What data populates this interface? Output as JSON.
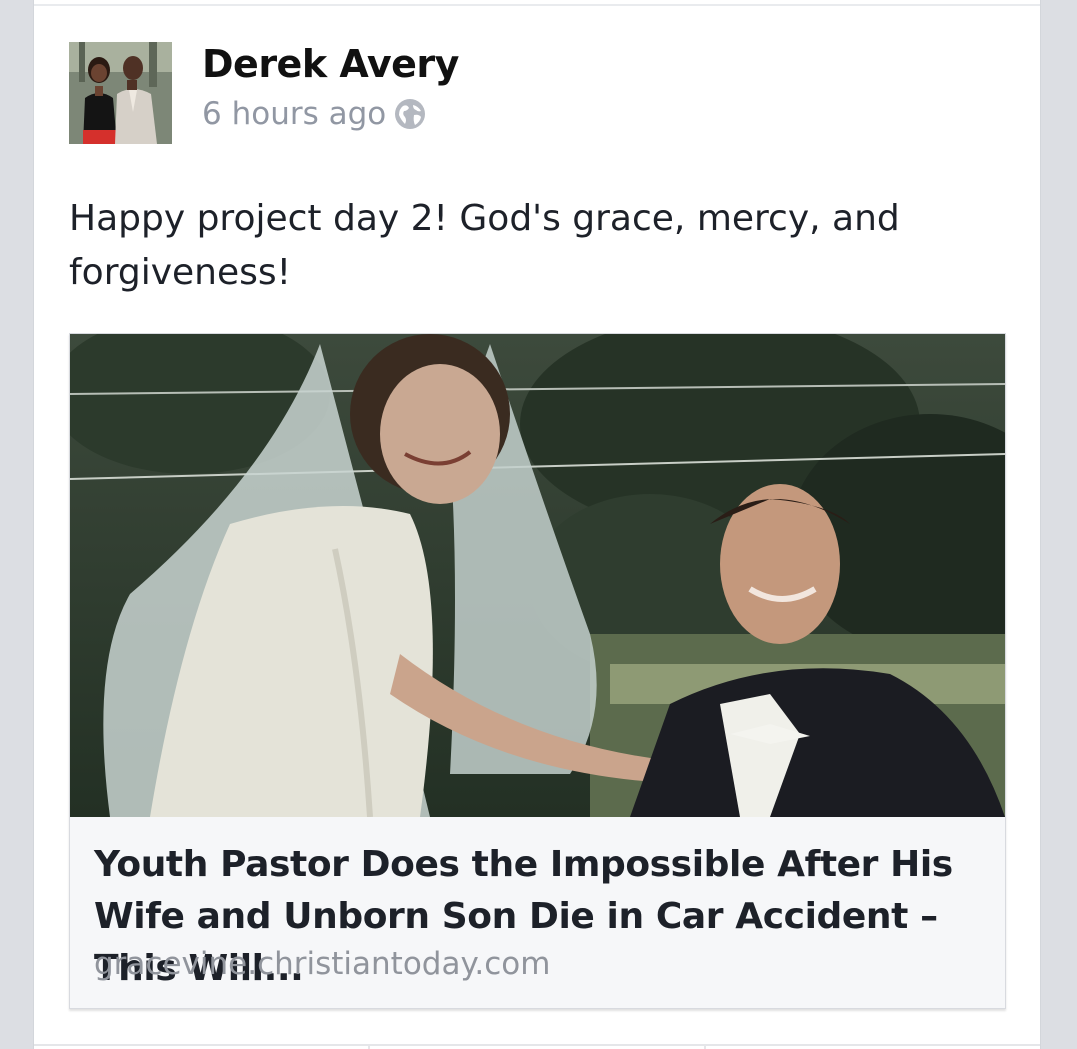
{
  "post": {
    "author_name": "Derek Avery",
    "timestamp": "6 hours ago",
    "privacy_icon": "globe-icon",
    "text": "Happy project day 2! God's grace, mercy, and forgiveness!"
  },
  "link_preview": {
    "title": "Youth Pastor Does the Impossible After His Wife and Unborn Son Die in Car Accident – This Will...",
    "domain": "gracevine.christiantoday.com"
  },
  "colors": {
    "page_background": "#dcdee3",
    "card_background": "#ffffff",
    "text_primary": "#1d2129",
    "text_secondary": "#9197a3",
    "link_box_background": "#f6f7f9"
  }
}
